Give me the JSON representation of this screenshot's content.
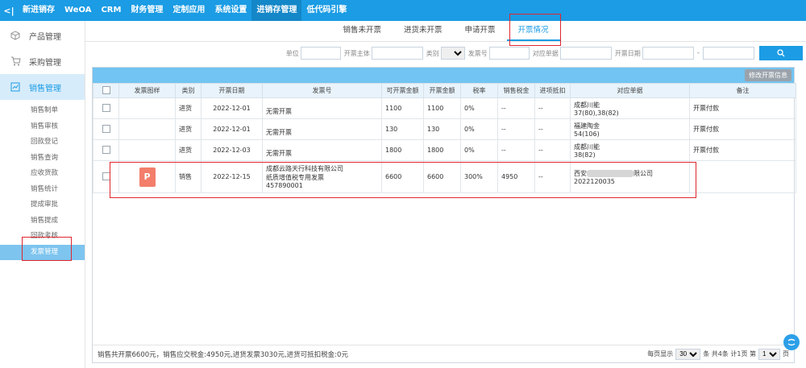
{
  "topnav": {
    "back": "<|",
    "items": [
      "新进销存",
      "WeOA",
      "CRM",
      "财务管理",
      "定制应用",
      "系统设置",
      "进销存管理",
      "低代码引擎"
    ],
    "active_index": 6
  },
  "sidebar": {
    "modules": [
      {
        "label": "产品管理",
        "icon": "product-icon"
      },
      {
        "label": "采购管理",
        "icon": "cart-icon"
      },
      {
        "label": "销售管理",
        "icon": "sales-icon"
      }
    ],
    "sub_items": [
      "销售制单",
      "销售审核",
      "回款登记",
      "销售查询",
      "应收货款",
      "销售统计",
      "提成审批",
      "销售提成",
      "回款考核",
      "发票管理"
    ],
    "active_sub": 9
  },
  "tabs": [
    "销售未开票",
    "进货未开票",
    "申请开票",
    "开票情况"
  ],
  "active_tab": 3,
  "filter": {
    "unit_label": "单位",
    "entity_label": "开票主体",
    "category_label": "类别",
    "invoice_no_label": "发票号",
    "doc_label": "对应单据",
    "date_label": "开票日期",
    "date_sep": "-",
    "search_icon": "search-icon"
  },
  "table": {
    "edit_button": "修改开票信息",
    "columns": [
      "",
      "发票图样",
      "类别",
      "开票日期",
      "发票号",
      "可开票金额",
      "开票金额",
      "税率",
      "销售税金",
      "进项抵扣",
      "对应单据",
      "备注"
    ],
    "rows": [
      {
        "category": "进货",
        "date": "2022-12-01",
        "invoice": [
          "无需开票"
        ],
        "available": "1100",
        "amount": "1100",
        "rate": "0%",
        "tax": "--",
        "deduct": "--",
        "doc": [
          "成都川能",
          "37(80),38(82)"
        ],
        "note": "开票付款"
      },
      {
        "category": "进货",
        "date": "2022-12-01",
        "invoice": [
          "无需开票"
        ],
        "available": "130",
        "amount": "130",
        "rate": "0%",
        "tax": "--",
        "deduct": "--",
        "doc": [
          "福建陶金",
          "54(106)"
        ],
        "note": "开票付款"
      },
      {
        "category": "进货",
        "date": "2022-12-03",
        "invoice": [
          "无需开票"
        ],
        "available": "1800",
        "amount": "1800",
        "rate": "0%",
        "tax": "--",
        "deduct": "--",
        "doc": [
          "成都川能",
          "38(82)"
        ],
        "note": "开票付款"
      },
      {
        "category": "销售",
        "date": "2022-12-15",
        "invoice": [
          "成都云路天行科技有限公司",
          "纸质增值税专用发票",
          "457890001"
        ],
        "available": "6600",
        "amount": "6600",
        "rate": "300%",
        "tax": "4950",
        "deduct": "--",
        "doc": [
          "西安",
          "限公司",
          "2022120035"
        ],
        "note": "",
        "image": "P"
      }
    ]
  },
  "footer": {
    "summary": "销售共开票6600元，销售应交税金:4950元,进货发票3030元,进货可抵扣税金:0元",
    "per_page_label": "每页显示",
    "per_page": "30",
    "info": "条 共4条 计1页 第",
    "page": "1",
    "page_suffix": "页"
  },
  "float_icon": "assistant-icon"
}
